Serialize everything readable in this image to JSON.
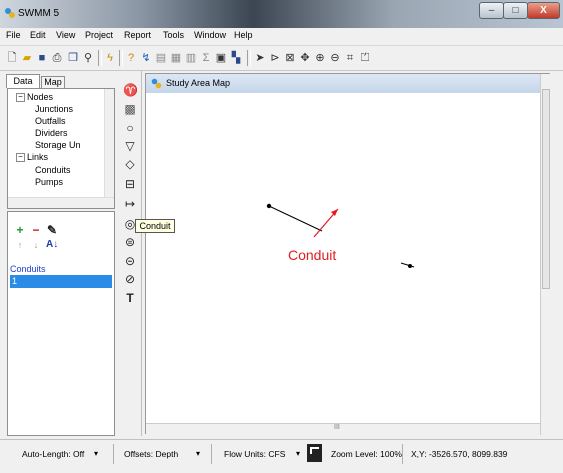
{
  "window": {
    "title": "SWMM 5",
    "minimize": "–",
    "maximize": "□",
    "close": "X"
  },
  "menu": [
    "File",
    "Edit",
    "View",
    "Project",
    "Report",
    "Tools",
    "Window",
    "Help"
  ],
  "toolbar_icons": [
    "new-file-icon",
    "open-folder-icon",
    "save-icon",
    "print-icon",
    "copy-icon",
    "find-icon",
    "run-icon",
    "query-icon",
    "graph-icon",
    "profile-icon",
    "table-icon",
    "stats-icon",
    "sum-icon",
    "options-icon",
    "arrange-icon",
    "select-icon",
    "vertex-icon",
    "region-icon",
    "pan-icon",
    "zoom-in-icon",
    "zoom-out-icon",
    "full-extent-icon",
    "measure-icon"
  ],
  "browser": {
    "tabs": {
      "data": "Data",
      "map": "Map"
    },
    "tree": [
      {
        "label": "Nodes",
        "level": 1,
        "expander": "−"
      },
      {
        "label": "Junctions",
        "level": 2
      },
      {
        "label": "Outfalls",
        "level": 2
      },
      {
        "label": "Dividers",
        "level": 2
      },
      {
        "label": "Storage Un",
        "level": 2
      },
      {
        "label": "Links",
        "level": 1,
        "expander": "−"
      },
      {
        "label": "Conduits",
        "level": 2
      },
      {
        "label": "Pumps",
        "level": 2
      }
    ],
    "buttons": {
      "add": "+",
      "delete": "−",
      "edit": "✎",
      "up": "↑",
      "down": "↓",
      "sort": "A↓"
    },
    "category_label": "Conduits",
    "items": [
      "1"
    ]
  },
  "palette_tooltip": "Conduit",
  "map": {
    "title": "Study Area Map",
    "annotation": "Conduit",
    "annotation_color": "#e31b23",
    "hscroll_glyph": "III"
  },
  "status": {
    "auto_length": "Auto-Length: Off",
    "offsets": "Offsets: Depth",
    "flow_units": "Flow Units: CFS",
    "zoom": "Zoom Level: 100%",
    "xy": "X,Y: -3526.570, 8099.839"
  }
}
